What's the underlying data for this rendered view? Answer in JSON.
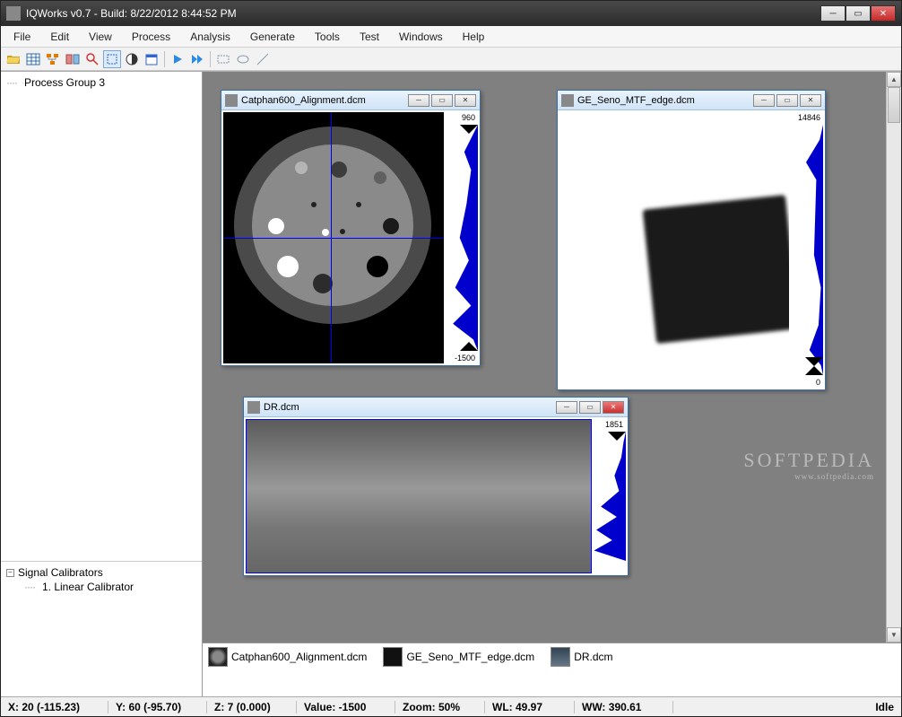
{
  "window": {
    "title": "IQWorks v0.7 - Build: 8/22/2012 8:44:52 PM"
  },
  "menu": {
    "items": [
      "File",
      "Edit",
      "View",
      "Process",
      "Analysis",
      "Generate",
      "Tools",
      "Test",
      "Windows",
      "Help"
    ]
  },
  "toolbar": {
    "icons": [
      "open-icon",
      "table-icon",
      "tree-icon",
      "compare-icon",
      "zoom-icon",
      "select-icon",
      "contrast-icon",
      "calendar-icon",
      "play-icon",
      "forward-icon",
      "region-icon",
      "ellipse-icon",
      "line-icon"
    ]
  },
  "tree_top": {
    "item0": "Process Group 3"
  },
  "tree_bot": {
    "root": "Signal Calibrators",
    "child0": "1. Linear Calibrator"
  },
  "subwindows": {
    "w1": {
      "title": "Catphan600_Alignment.dcm",
      "hist_max": "960",
      "hist_min": "-1500"
    },
    "w2": {
      "title": "GE_Seno_MTF_edge.dcm",
      "hist_max": "14846",
      "hist_min": "0"
    },
    "w3": {
      "title": "DR.dcm",
      "hist_max": "1851"
    }
  },
  "thumbs": {
    "t1": "Catphan600_Alignment.dcm",
    "t2": "GE_Seno_MTF_edge.dcm",
    "t3": "DR.dcm"
  },
  "status": {
    "x": "X:  20 (-115.23)",
    "y": "Y:  60 (-95.70)",
    "z": "Z:  7 (0.000)",
    "value": "Value:  -1500",
    "zoom": "Zoom:  50%",
    "wl": "WL:  49.97",
    "ww": "WW:  390.61",
    "idle": "Idle"
  },
  "watermark": {
    "big": "SOFTPEDIA",
    "small": "www.softpedia.com"
  }
}
